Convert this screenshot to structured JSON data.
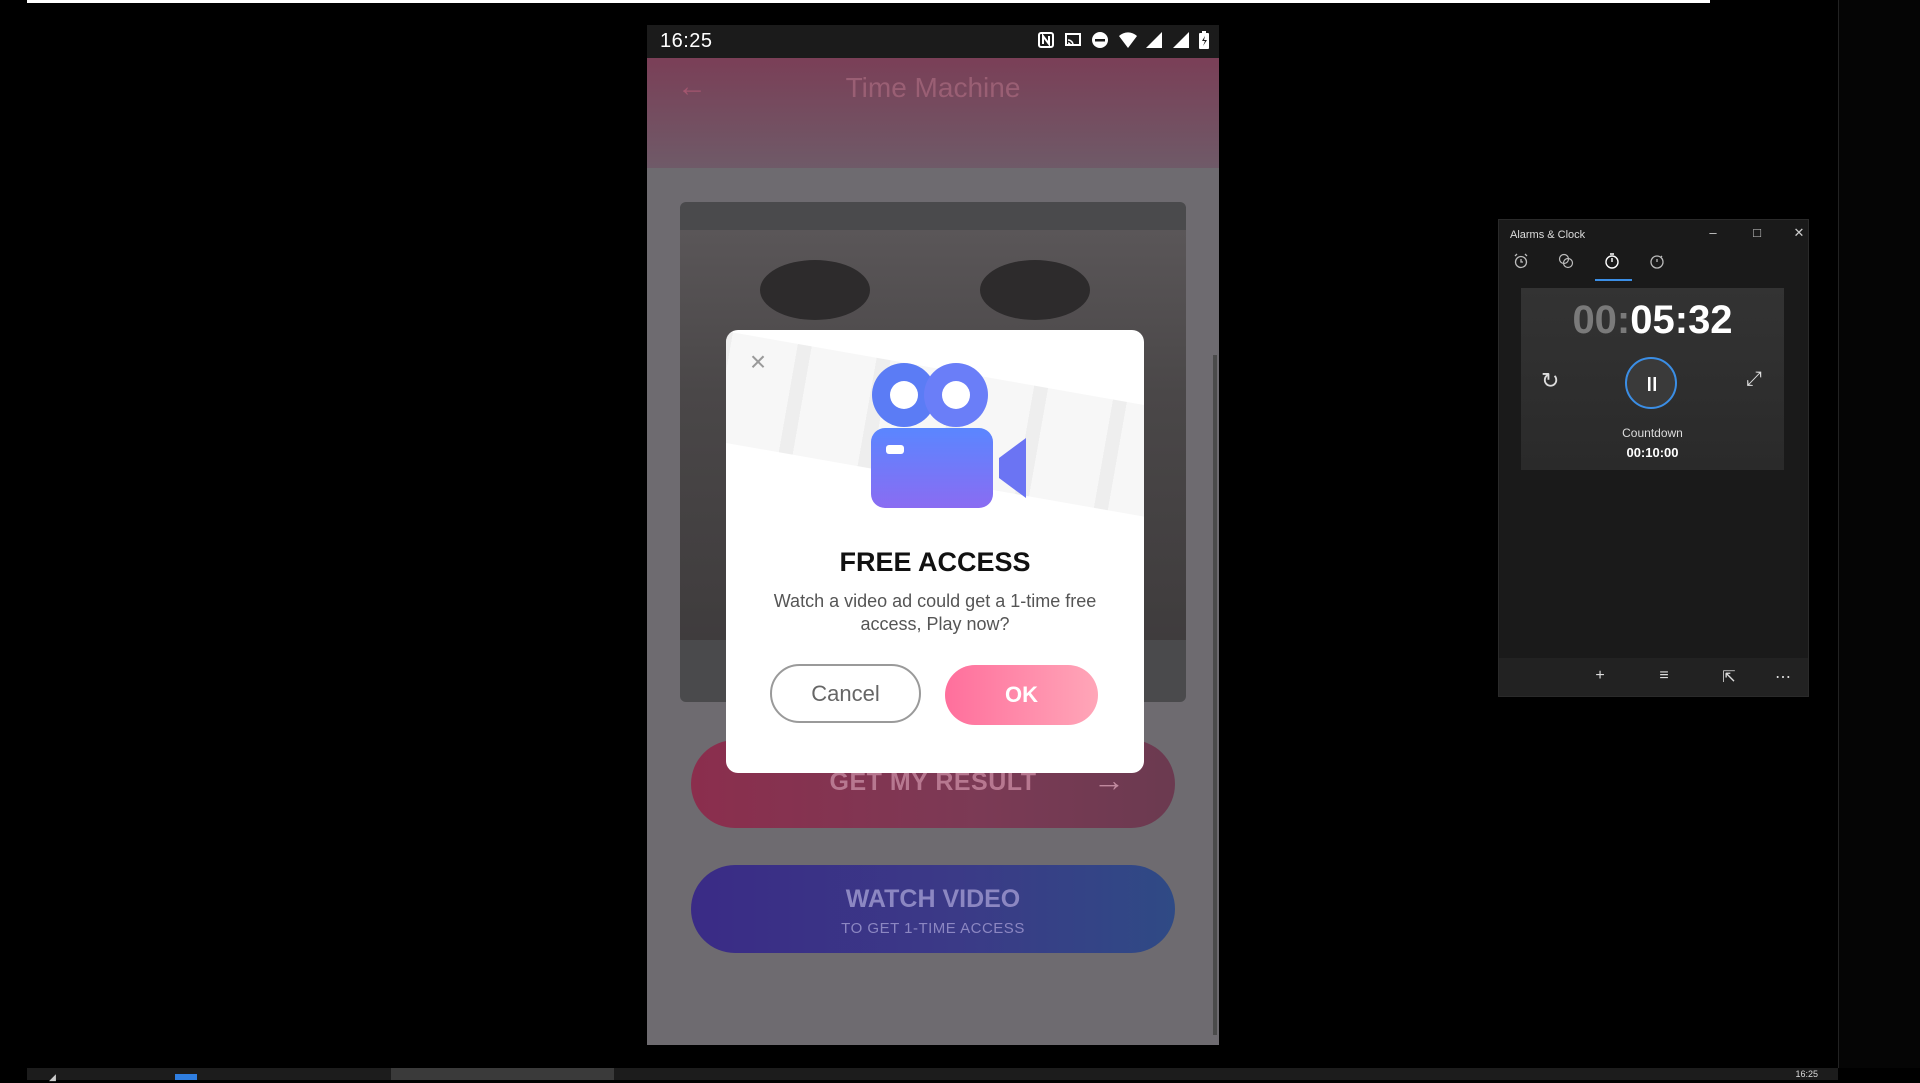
{
  "phone": {
    "status_time": "16:25",
    "app_title": "Time Machine",
    "get_result_label": "GET MY RESULT",
    "watch_video_line1": "WATCH VIDEO",
    "watch_video_line2": "TO GET 1-TIME ACCESS",
    "dialog": {
      "heading": "FREE ACCESS",
      "message": "Watch a video ad could get a 1-time free access, Play now?",
      "cancel_label": "Cancel",
      "ok_label": "OK"
    }
  },
  "clock_window": {
    "title": "Alarms & Clock",
    "timer_hours": "00:",
    "timer_rest": "05:32",
    "timer_name": "Countdown",
    "timer_duration": "00:10:00",
    "accent_color": "#3b8ee5"
  },
  "taskbar": {
    "tray_time": "16:25"
  },
  "icons": {
    "status": [
      "nfc-icon",
      "cast-icon",
      "do-not-disturb-icon",
      "wifi-icon",
      "signal-icon",
      "signal-icon",
      "battery-icon"
    ],
    "clock_tabs": [
      "alarm-icon",
      "world-clock-icon",
      "timer-icon",
      "stopwatch-icon"
    ],
    "clock_bottom": [
      "add-icon",
      "edit-list-icon",
      "pin-icon",
      "more-icon"
    ]
  }
}
